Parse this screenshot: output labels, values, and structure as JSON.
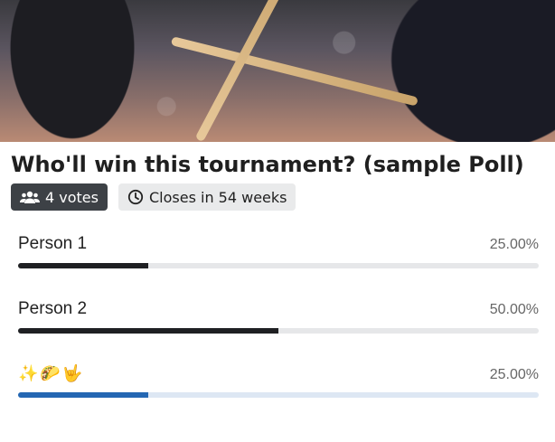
{
  "poll": {
    "title": "Who'll win this tournament? (sample Poll)",
    "votes_label": "4 votes",
    "closes_label": "Closes in 54 weeks",
    "options": [
      {
        "label": "Person 1",
        "percent_label": "25.00%",
        "fraction": 0.25,
        "selected": false
      },
      {
        "label": "Person 2",
        "percent_label": "50.00%",
        "fraction": 0.5,
        "selected": false
      },
      {
        "label": "✨🌮🤟",
        "percent_label": "25.00%",
        "fraction": 0.25,
        "selected": true
      }
    ]
  },
  "colors": {
    "bar_default": "#1f2023",
    "bar_selected": "#2467b3",
    "track": "#e6e7e9"
  },
  "icons": {
    "votes": "users-icon",
    "closes": "clock-icon"
  }
}
